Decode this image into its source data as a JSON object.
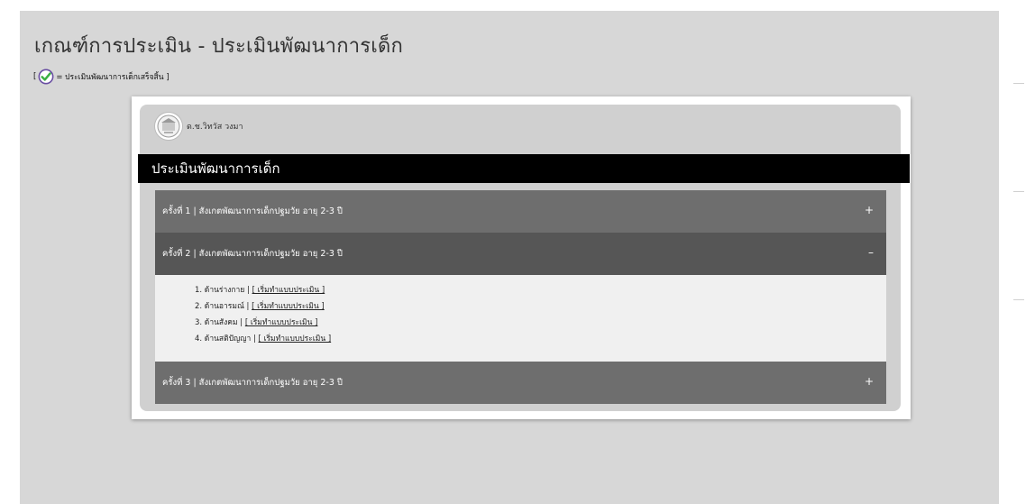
{
  "page": {
    "title": "เกณฑ์การประเมิน - ประเมินพัฒนาการเด็ก",
    "legend_open": "[",
    "legend_text": "= ประเมินพัฒนาการเด็กเสร็จสิ้น ]",
    "legend_icon": "check-circle-icon"
  },
  "card": {
    "user_name": "ด.ช.วิทวัส วงมา",
    "avatar_icon": "school-logo-icon",
    "section_title": "ประเมินพัฒนาการเด็ก"
  },
  "sessions": [
    {
      "label": "ครั้งที่ 1 | สังเกตพัฒนาการเด็กปฐมวัย อายุ 2-3 ปี",
      "sign": "+"
    },
    {
      "label": "ครั้งที่ 2 | สังเกตพัฒนาการเด็กปฐมวัย อายุ 2-3 ปี",
      "sign": "–"
    },
    {
      "label": "ครั้งที่ 3 | สังเกตพัฒนาการเด็กปฐมวัย อายุ 2-3 ปี",
      "sign": "+"
    }
  ],
  "session2_items": [
    {
      "label": "1. ด้านร่างกาย | ",
      "link": "[ เริ่มทำแบบประเมิน ]"
    },
    {
      "label": "2. ด้านอารมณ์ | ",
      "link": "[ เริ่มทำแบบประเมิน ]"
    },
    {
      "label": "3. ด้านสังคม | ",
      "link": "[ เริ่มทำแบบประเมิน ]"
    },
    {
      "label": "4. ด้านสติปัญญา | ",
      "link": "[ เริ่มทำแบบประเมิน ]"
    }
  ],
  "colors": {
    "background": "#d7d7d7",
    "accordion_header": "#6e6e6e",
    "accordion_header_active": "#565656",
    "section_bar": "#000000",
    "check_green": "#3cb043",
    "check_ring": "#6a4fa3"
  }
}
